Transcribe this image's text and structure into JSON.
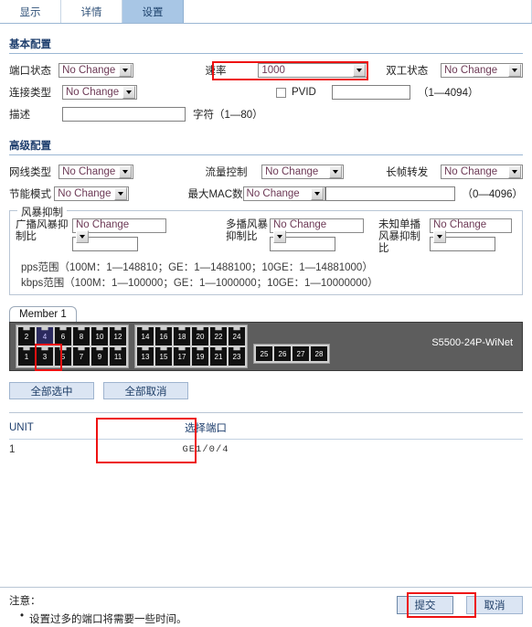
{
  "tabs": [
    {
      "label": "显示",
      "active": false
    },
    {
      "label": "详情",
      "active": false
    },
    {
      "label": "设置",
      "active": true
    }
  ],
  "basic": {
    "title": "基本配置",
    "port_state_label": "端口状态",
    "port_state_value": "No Change",
    "speed_label": "速率",
    "speed_value": "1000",
    "duplex_label": "双工状态",
    "duplex_value": "No Change",
    "link_type_label": "连接类型",
    "link_type_value": "No Change",
    "pvid_label": "PVID",
    "pvid_value": "",
    "pvid_range": "（1—4094）",
    "desc_label": "描述",
    "desc_value": "",
    "desc_range": "字符（1—80）"
  },
  "advanced": {
    "title": "高级配置",
    "cable_type_label": "网线类型",
    "cable_type_value": "No Change",
    "flow_control_label": "流量控制",
    "flow_control_value": "No Change",
    "jumbo_label": "长帧转发",
    "jumbo_value": "No Change",
    "energy_label": "节能模式",
    "energy_value": "No Change",
    "max_mac_label": "最大MAC数",
    "max_mac_value": "No Change",
    "max_mac_input": "",
    "max_mac_range": "（0—4096）"
  },
  "storm": {
    "legend": "风暴抑制",
    "broadcast_label": "广播风暴抑制比",
    "broadcast_value": "No Change",
    "broadcast_input": "",
    "multicast_label": "多播风暴抑制比",
    "multicast_value": "No Change",
    "multicast_input": "",
    "unknown_unicast_label": "未知单播风暴抑制比",
    "unknown_unicast_value": "No Change",
    "unknown_unicast_input": "",
    "pps_range": "pps范围（100M：1—148810；GE：1—1488100；10GE：1—14881000）",
    "kbps_range": "kbps范围（100M：1—100000；GE：1—1000000；10GE：1—10000000）"
  },
  "device": {
    "member_tab": "Member 1",
    "model": "S5500-24P-WiNet",
    "ports_top": [
      "2",
      "4",
      "6",
      "8",
      "10",
      "12",
      "14",
      "16",
      "18",
      "20",
      "22",
      "24"
    ],
    "ports_bottom": [
      "1",
      "3",
      "5",
      "7",
      "9",
      "11",
      "13",
      "15",
      "17",
      "19",
      "21",
      "23"
    ],
    "sfp_ports": [
      "25",
      "26",
      "27",
      "28"
    ],
    "selected_port": "4",
    "select_all_label": "全部选中",
    "deselect_all_label": "全部取消"
  },
  "table": {
    "headers": [
      "UNIT",
      "选择端口"
    ],
    "rows": [
      {
        "unit": "1",
        "port": "GE1/0/4"
      }
    ]
  },
  "footer": {
    "note_title": "注意：",
    "note_items": [
      "设置过多的端口将需要一些时间。"
    ],
    "submit_label": "提交",
    "cancel_label": "取消"
  },
  "colors": {
    "accent": "#a8c6e5",
    "highlight": "#ee1111",
    "select_text": "#6d3a56",
    "panel": "#5d5d5d"
  }
}
